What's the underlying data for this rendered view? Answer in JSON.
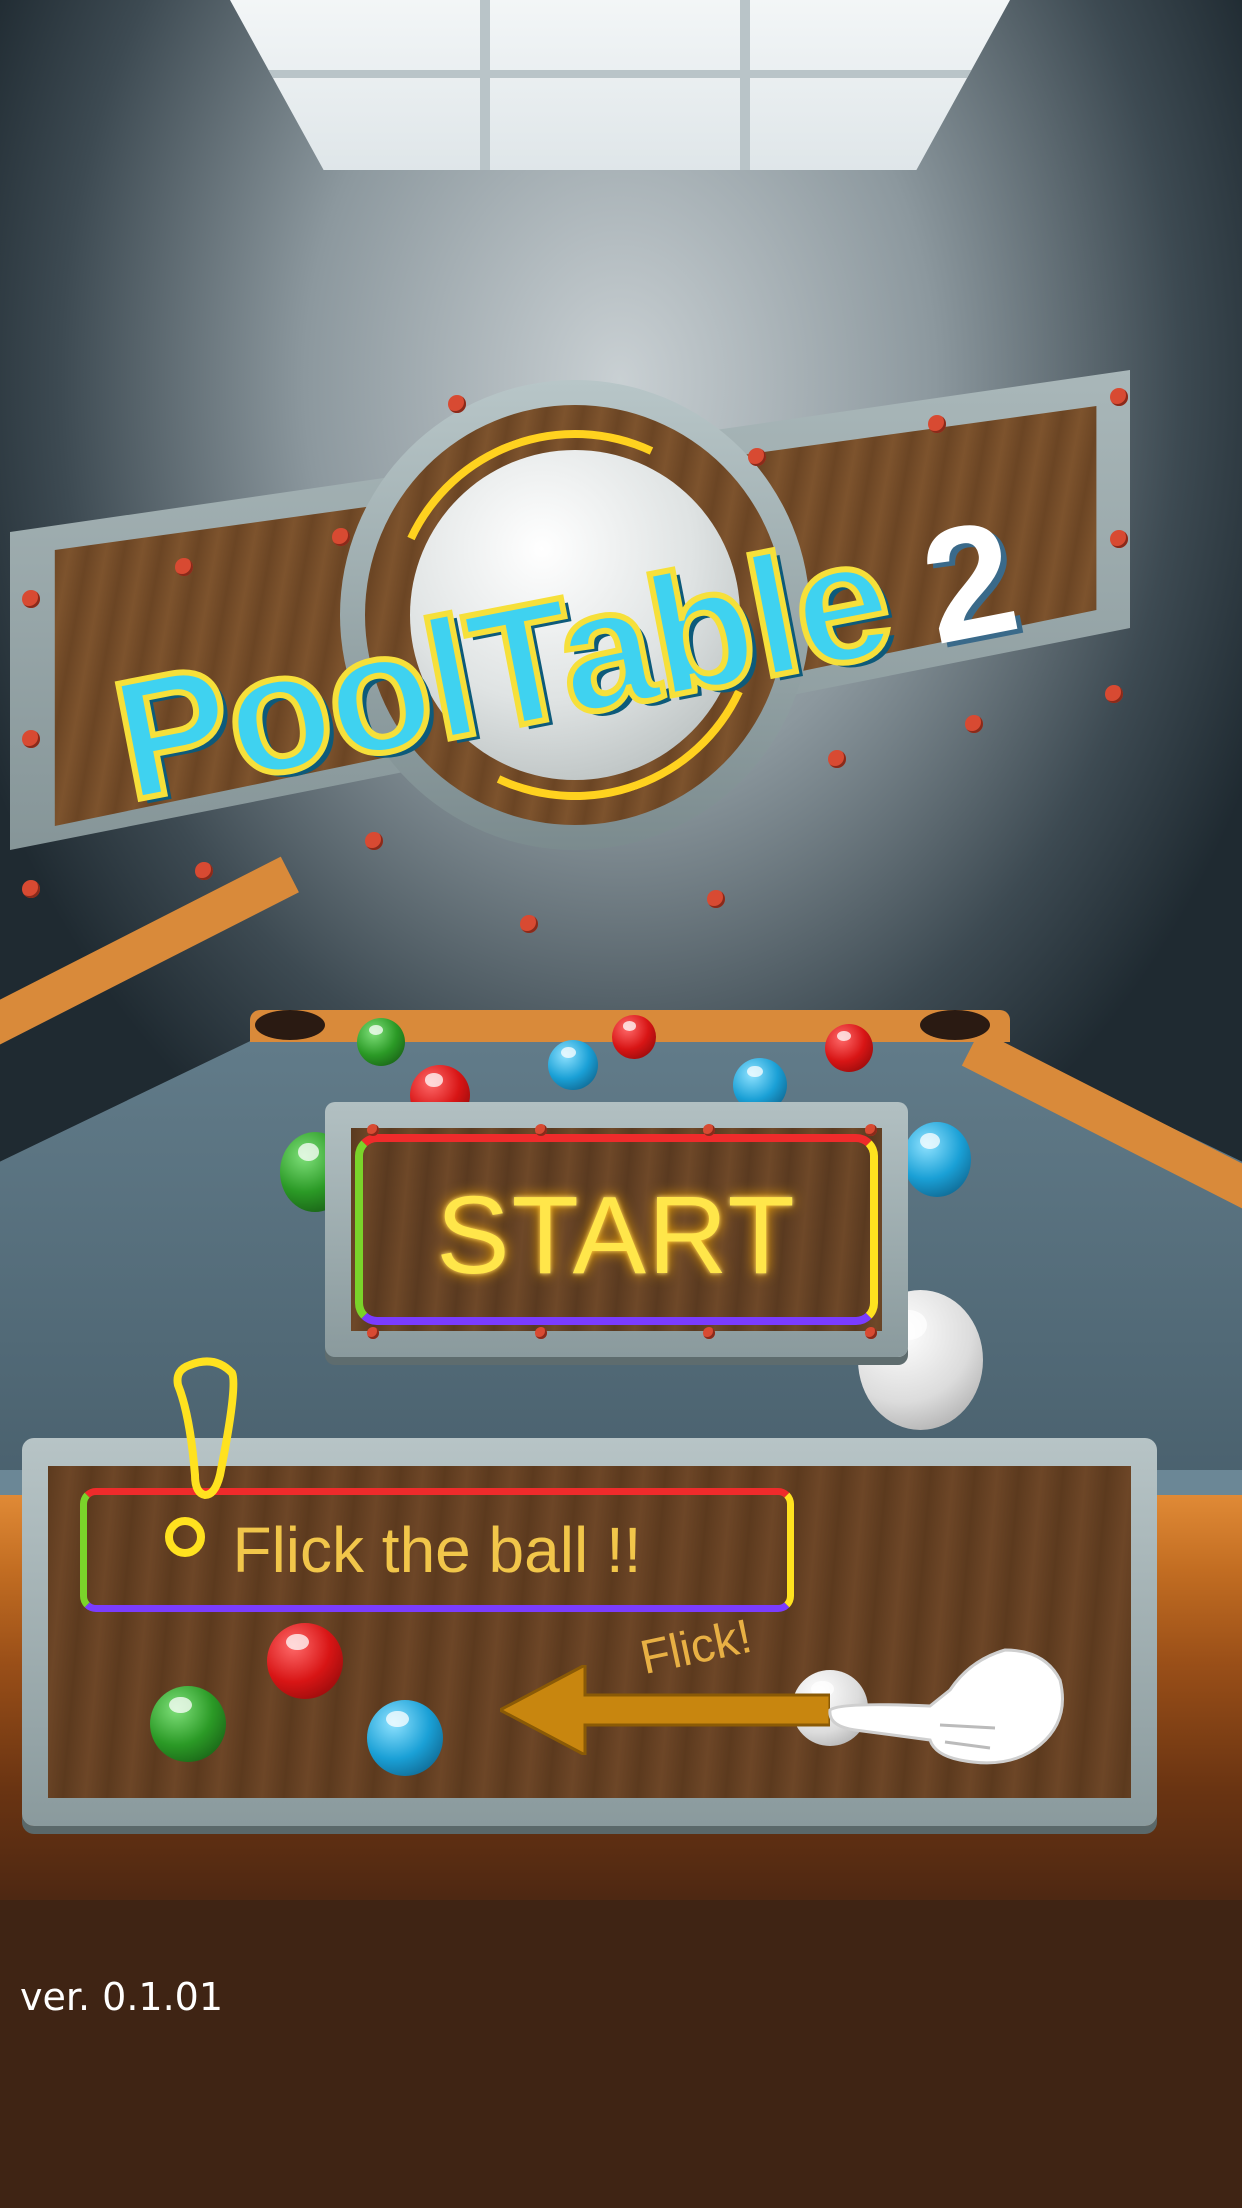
{
  "logo": {
    "title": "PoolTable",
    "number": "2"
  },
  "start_button": {
    "label": "START"
  },
  "tutorial": {
    "instruction": "Flick the ball !!",
    "flick_label": "Flick!"
  },
  "version": {
    "text": "ver. 0.1.01"
  },
  "colors": {
    "neon_red": "#ef2b2b",
    "neon_yellow": "#ffe21f",
    "neon_green": "#7ad42a",
    "neon_purple": "#7a3cff",
    "wood": "#6d4627",
    "felt": "#5a7482"
  }
}
